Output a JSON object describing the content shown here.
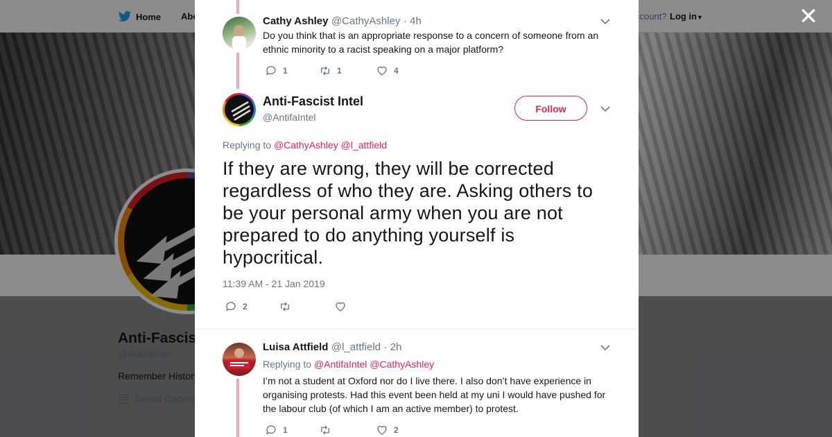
{
  "background": {
    "nav": {
      "home_label": "Home",
      "about_label": "Abo",
      "account_question": "ccount?",
      "login_label": "Log in"
    },
    "profile": {
      "name": "Anti-Fascis",
      "handle": "@AntifaIntel",
      "bio": "Remember History",
      "joined": "Joined Decem"
    }
  },
  "modal": {
    "close_icon": "close-icon",
    "parent_reply": {
      "name": "Cathy Ashley",
      "handle": "@CathyAshley",
      "time": "· 4h",
      "text": "Do you think that is an appropriate response to a concern of someone from an ethnic minority to a racist speaking on a major platform?",
      "replies": "1",
      "retweets": "1",
      "likes": "4"
    },
    "main_tweet": {
      "name": "Anti-Fascist Intel",
      "handle": "@AntifaIntel",
      "follow_label": "Follow",
      "replying_prefix": "Replying to",
      "replying_to_1": "@CathyAshley",
      "replying_to_2": "@l_attfield",
      "text": "If they are wrong, they will be corrected regardless of who they are. Asking others to be your personal army when you are not prepared to do anything yourself is hypocritical.",
      "timestamp": "11:39 AM - 21 Jan 2019",
      "replies": "2",
      "retweets": "",
      "likes": ""
    },
    "child_reply": {
      "name": "Luisa Attfield",
      "handle": "@l_attfield",
      "time": "· 2h",
      "replying_prefix": "Replying to",
      "replying_to_1": "@AntifaIntel",
      "replying_to_2": "@CathyAshley",
      "text": "I’m not a student at Oxford nor do I live there. I also don’t have experience in organising protests. Had this event been held at my uni I would have pushed for the labour club (of which I am an active member) to protest.",
      "replies": "1",
      "retweets": "",
      "likes": "2"
    }
  },
  "colors": {
    "accent": "#e0245e",
    "thread": "#f4a6c2",
    "muted": "#657786",
    "text": "#14171a"
  }
}
